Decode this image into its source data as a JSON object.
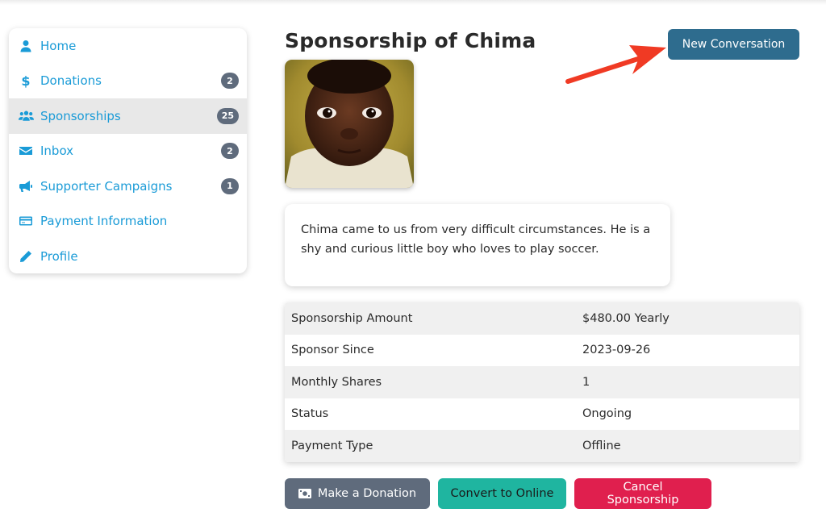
{
  "sidebar": {
    "items": [
      {
        "label": "Home",
        "icon": "user-icon",
        "badge": null,
        "active": false
      },
      {
        "label": "Donations",
        "icon": "dollar-icon",
        "badge": "2",
        "active": false
      },
      {
        "label": "Sponsorships",
        "icon": "users-icon",
        "badge": "25",
        "active": true
      },
      {
        "label": "Inbox",
        "icon": "envelope-icon",
        "badge": "2",
        "active": false
      },
      {
        "label": "Supporter Campaigns",
        "icon": "megaphone-icon",
        "badge": "1",
        "active": false
      },
      {
        "label": "Payment Information",
        "icon": "credit-card-icon",
        "badge": null,
        "active": false
      },
      {
        "label": "Profile",
        "icon": "pencil-icon",
        "badge": null,
        "active": false
      }
    ]
  },
  "main": {
    "title": "Sponsorship of Chima",
    "new_conversation_label": "New Conversation",
    "bio": "Chima came to us from very difficult circumstances. He is a shy and curious little boy who loves to play soccer.",
    "details": [
      {
        "label": "Sponsorship Amount",
        "value": "$480.00 Yearly"
      },
      {
        "label": "Sponsor Since",
        "value": "2023-09-26"
      },
      {
        "label": "Monthly Shares",
        "value": "1"
      },
      {
        "label": "Status",
        "value": "Ongoing"
      },
      {
        "label": "Payment Type",
        "value": "Offline"
      }
    ],
    "actions": {
      "donate_label": "Make a Donation",
      "convert_label": "Convert to Online",
      "cancel_label": "Cancel Sponsorship"
    }
  },
  "colors": {
    "link": "#1a9bd7",
    "badge": "#5f6b7c",
    "primary": "#2e6c8e",
    "teal": "#1fb5a0",
    "danger": "#e01f4e",
    "annotation_arrow": "#f03a24"
  }
}
